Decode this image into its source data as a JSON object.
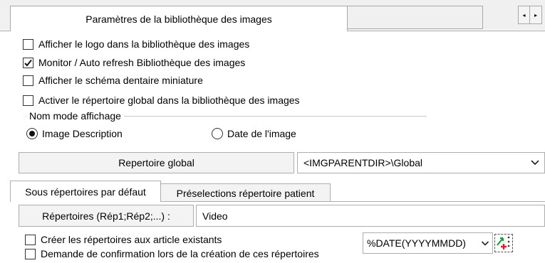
{
  "tabs": {
    "active_label": "Paramètres de la bibliothèque des images",
    "nav_prev": "◂",
    "nav_next": "▸"
  },
  "options": [
    {
      "label": "Afficher le logo dans la bibliothèque des images",
      "checked": false
    },
    {
      "label": "Monitor / Auto refresh Bibliothèque des images",
      "checked": true
    },
    {
      "label": "Afficher le schéma dentaire miniature",
      "checked": false
    },
    {
      "label": "Activer le répertoire global dans la bibliothèque des images",
      "checked": false
    }
  ],
  "display_mode": {
    "group_title": "Nom mode affichage",
    "options": [
      {
        "label": "Image Description",
        "selected": true
      },
      {
        "label": "Date de l'image",
        "selected": false
      }
    ]
  },
  "global_dir": {
    "button_label": "Repertoire global",
    "value": "<IMGPARENTDIR>\\Global"
  },
  "subtabs": [
    {
      "label": "Sous répertoires par défaut",
      "active": true
    },
    {
      "label": "Préselections répertoire patient",
      "active": false
    }
  ],
  "subdirs": {
    "button_label": "Répertoires (Rép1;Rép2;...) :",
    "value": "Video",
    "create_existing_label": "Créer les répertoires aux article existants",
    "create_existing_checked": false,
    "confirm_label": "Demande de confirmation lors de la création de ces répertoires",
    "confirm_checked": false,
    "date_format": "%DATE(YYYYMMDD)"
  },
  "icons": {
    "check": "check-icon",
    "dropdown": "chevron-down-icon",
    "insert_variable": "insert-variable-icon"
  },
  "colors": {
    "border": "#adadad",
    "panel_bg": "#ffffff",
    "strip_bg": "#f0f0f0",
    "icon_green": "#1e9e3a",
    "icon_red": "#d8202a"
  }
}
